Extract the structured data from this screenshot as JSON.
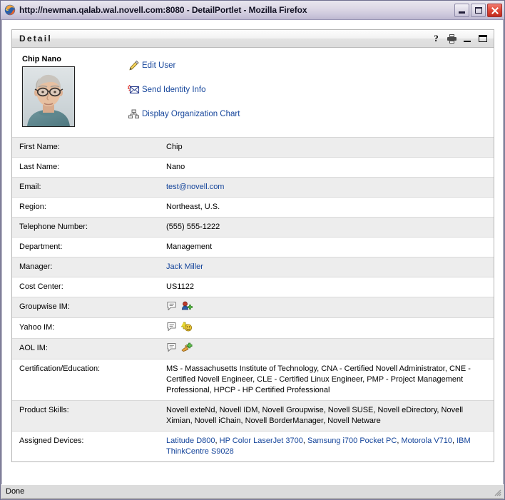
{
  "window": {
    "title": "http://newman.qalab.wal.novell.com:8080 - DetailPortlet - Mozilla Firefox",
    "app_icon": "firefox-icon",
    "minimize_label": "Minimize",
    "maximize_label": "Maximize",
    "close_label": "Close"
  },
  "portlet": {
    "title": "Detail",
    "icons": [
      {
        "name": "help-icon",
        "glyph": "?"
      },
      {
        "name": "print-icon",
        "glyph": ""
      },
      {
        "name": "minimize-icon",
        "glyph": ""
      },
      {
        "name": "maximize-icon",
        "glyph": ""
      }
    ]
  },
  "profile": {
    "name": "Chip Nano",
    "photo_alt": "Chip Nano portrait photo",
    "actions": [
      {
        "icon": "pencil-icon",
        "label": "Edit User"
      },
      {
        "icon": "envelope-icon",
        "label": "Send Identity Info"
      },
      {
        "icon": "org-chart-icon",
        "label": "Display Organization Chart"
      }
    ]
  },
  "detail_rows": [
    {
      "label": "First Name:",
      "value": "Chip",
      "type": "text"
    },
    {
      "label": "Last Name:",
      "value": "Nano",
      "type": "text"
    },
    {
      "label": "Email:",
      "value": "test@novell.com",
      "type": "link"
    },
    {
      "label": "Region:",
      "value": "Northeast, U.S.",
      "type": "text"
    },
    {
      "label": "Telephone Number:",
      "value": "(555) 555-1222",
      "type": "text"
    },
    {
      "label": "Department:",
      "value": "Management",
      "type": "text"
    },
    {
      "label": "Manager:",
      "value": "Jack Miller",
      "type": "link"
    },
    {
      "label": "Cost Center:",
      "value": "US1122",
      "type": "text"
    },
    {
      "label": "Groupwise IM:",
      "value": "",
      "type": "im",
      "im_kind": "groupwise"
    },
    {
      "label": "Yahoo IM:",
      "value": "",
      "type": "im",
      "im_kind": "yahoo"
    },
    {
      "label": "AOL IM:",
      "value": "",
      "type": "im",
      "im_kind": "aol"
    },
    {
      "label": "Certification/Education:",
      "value": "MS - Massachusetts Institute of Technology, CNA - Certified Novell Administrator, CNE - Certified Novell Engineer, CLE - Certified Linux Engineer, PMP - Project Management Professional, HPCP - HP Certified Professional",
      "type": "text"
    },
    {
      "label": "Product Skills:",
      "value": "Novell exteNd, Novell IDM, Novell Groupwise, Novell SUSE, Novell eDirectory, Novell Ximian, Novell iChain, Novell BorderManager, Novell Netware",
      "type": "text"
    },
    {
      "label": "Assigned Devices:",
      "value": "Latitude D800, HP Color LaserJet 3700, Samsung i700 Pocket PC, Motorola V710, IBM ThinkCentre S9028",
      "type": "linklist",
      "links": [
        "Latitude D800",
        "HP Color LaserJet 3700",
        "Samsung i700 Pocket PC",
        "Motorola V710",
        "IBM ThinkCentre S9028"
      ]
    }
  ],
  "im_tooltips": {
    "chat": "Start chat",
    "add": "Add contact"
  },
  "statusbar": {
    "text": "Done"
  },
  "colors": {
    "link": "#15459b",
    "row_alt": "#ededed",
    "row_base": "#ffffff",
    "titlebar": "#cdc8dc",
    "close_button": "#d63b28",
    "portlet_header": "#e6e6e6"
  }
}
